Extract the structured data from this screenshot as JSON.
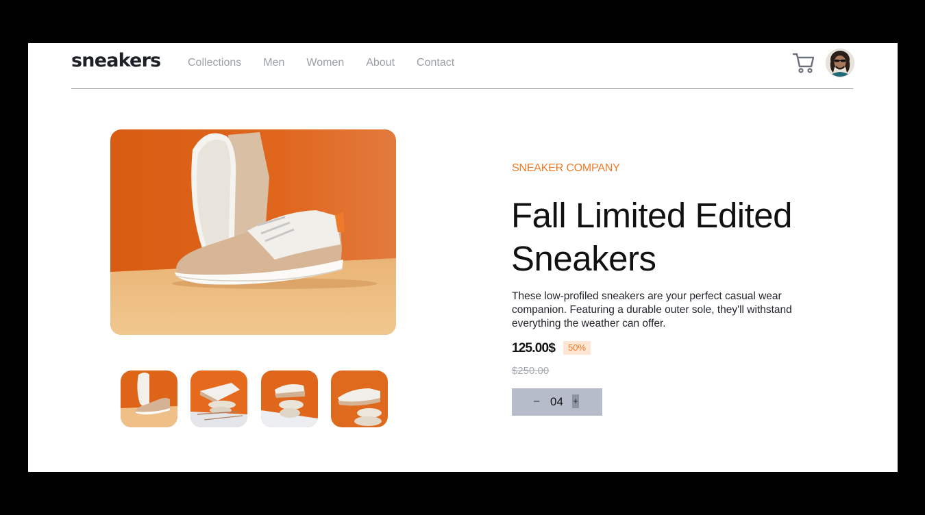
{
  "header": {
    "logo": "sneakers",
    "nav": [
      "Collections",
      "Men",
      "Women",
      "About",
      "Contact"
    ]
  },
  "icons": {
    "cart": "cart-icon",
    "avatar": "user-avatar"
  },
  "product": {
    "company": "SNEAKER COMPANY",
    "title": "Fall Limited Edited Sneakers",
    "description": "These low-profiled sneakers are your perfect casual wear companion. Featuring a durable outer sole, they'll withstand everything the weather can offer.",
    "price": "125.00$",
    "discount": "50%",
    "old_price": "$250.00",
    "quantity": "04",
    "minus_label": "–",
    "plus_label": "+"
  },
  "colors": {
    "accent": "#f07a28",
    "accent_pale": "#fde6d4",
    "text_dark": "#1d2026",
    "nav_grey": "#9a9ea6",
    "stepper_bg": "#b6bcc9"
  },
  "gallery": {
    "selected_index": 0,
    "thumbnail_count": 4
  }
}
